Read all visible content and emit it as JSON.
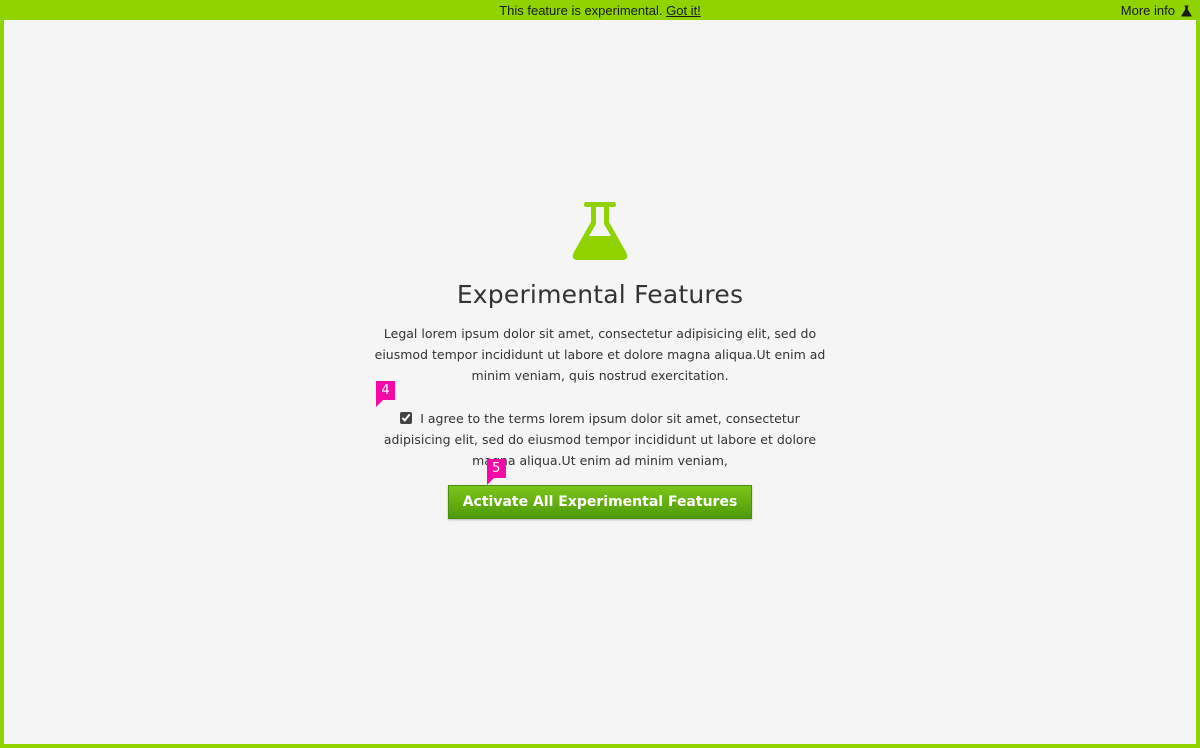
{
  "banner": {
    "message": "This feature is experimental.",
    "dismiss_link": "Got it!",
    "more_info": "More info",
    "icon": "flask-icon"
  },
  "main": {
    "icon": "flask-icon",
    "title": "Experimental Features",
    "legal_text": "Legal lorem ipsum dolor sit amet, consectetur adipisicing elit, sed do eiusmod tempor incididunt ut labore et dolore magna aliqua.Ut enim ad minim veniam, quis nostrud exercitation.",
    "agree_text": "I agree to the terms lorem ipsum dolor sit amet, consectetur adipisicing elit, sed do eiusmod tempor incididunt ut labore et dolore magna aliqua.Ut enim ad minim veniam,",
    "agree_checked": true,
    "activate_button": "Activate All Experimental Features"
  },
  "annotations": {
    "checkbox_marker": "4",
    "button_marker": "5"
  },
  "colors": {
    "accent": "#8fd400",
    "button": "#5ca40f",
    "marker": "#f40aa6"
  }
}
